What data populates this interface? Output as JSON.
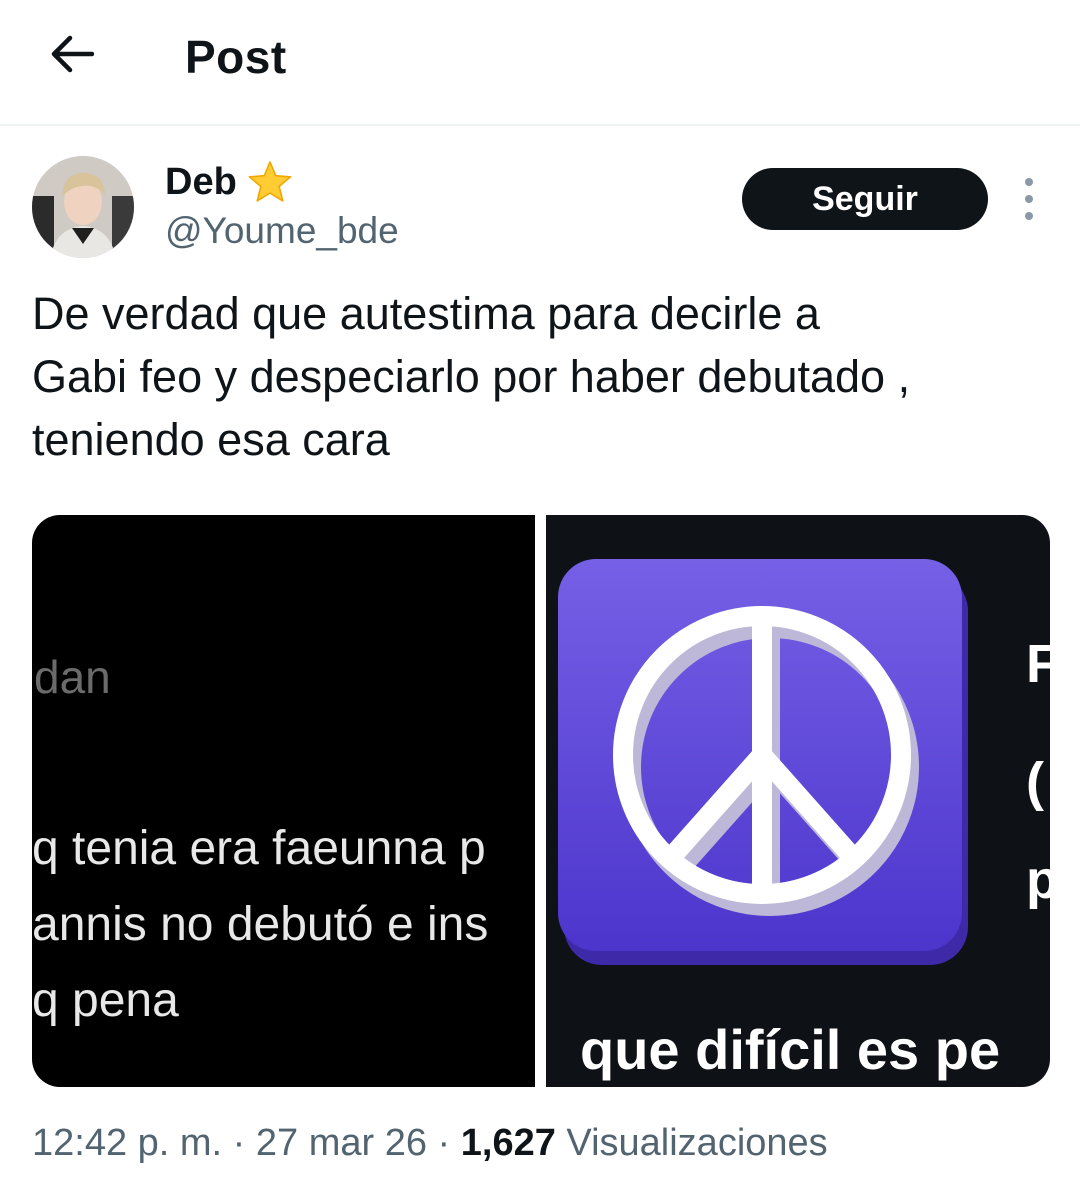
{
  "header": {
    "title": "Post",
    "back_icon": "arrow-left-icon"
  },
  "author": {
    "name": "Deb",
    "badge_icon": "star-icon",
    "handle": "@Youme_bde",
    "follow_label": "Seguir",
    "more_icon": "more-vertical-icon"
  },
  "post": {
    "text": "De verdad que autestima para decirle a\nGabi feo y despeciarlo por haber debutado ,\nteniendo esa cara"
  },
  "media": {
    "image1": {
      "top_text": "dan",
      "lines": [
        "q tenia era faeunna p",
        "annis no debutó e ins",
        "q pena"
      ]
    },
    "image2": {
      "icon": "peace-sign-icon",
      "icon_color": "#5b3fd6",
      "caption": "que difícil es pe",
      "edge_chars": [
        "F",
        "(",
        "p"
      ]
    }
  },
  "meta": {
    "time": "12:42 p. m.",
    "sep1": " · ",
    "date": "27 mar 26",
    "sep2": " · ",
    "views": "1,627",
    "views_label": " Visualizaciones"
  }
}
